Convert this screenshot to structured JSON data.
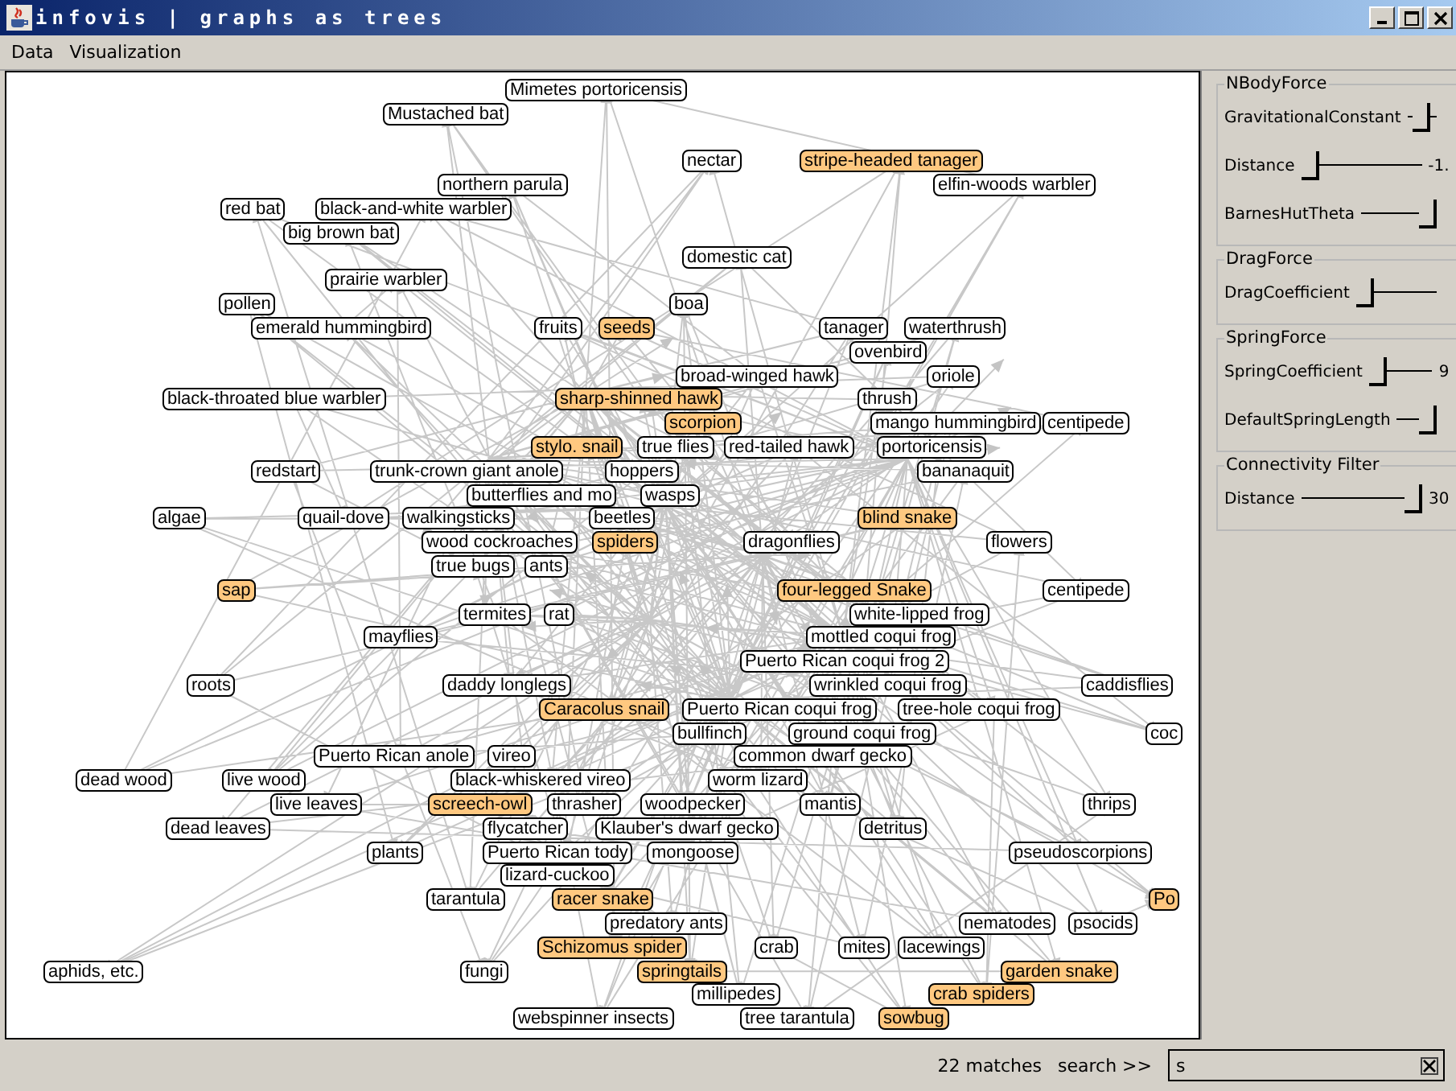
{
  "window": {
    "title": "infovis | graphs as trees"
  },
  "menu": [
    "Data",
    "Visualization"
  ],
  "graph": {
    "nodes": [
      {
        "label": "Mimetes portoricensis",
        "matched": false
      },
      {
        "label": "Mustached bat",
        "matched": false
      },
      {
        "label": "nectar",
        "matched": false
      },
      {
        "label": "stripe-headed tanager",
        "matched": true
      },
      {
        "label": "northern parula",
        "matched": false
      },
      {
        "label": "elfin-woods warbler",
        "matched": false
      },
      {
        "label": "red bat",
        "matched": false
      },
      {
        "label": "black-and-white warbler",
        "matched": false
      },
      {
        "label": "big brown bat",
        "matched": false
      },
      {
        "label": "domestic cat",
        "matched": false
      },
      {
        "label": "prairie warbler",
        "matched": false
      },
      {
        "label": "pollen",
        "matched": false
      },
      {
        "label": "boa",
        "matched": false
      },
      {
        "label": "emerald hummingbird",
        "matched": false
      },
      {
        "label": "fruits",
        "matched": false
      },
      {
        "label": "seeds",
        "matched": true
      },
      {
        "label": "tanager",
        "matched": false
      },
      {
        "label": "waterthrush",
        "matched": false
      },
      {
        "label": "ovenbird",
        "matched": false
      },
      {
        "label": "broad-winged hawk",
        "matched": false
      },
      {
        "label": "oriole",
        "matched": false
      },
      {
        "label": "black-throated blue warbler",
        "matched": false
      },
      {
        "label": "sharp-shinned hawk",
        "matched": true
      },
      {
        "label": "thrush",
        "matched": false
      },
      {
        "label": "scorpion",
        "matched": true
      },
      {
        "label": "mango hummingbird",
        "matched": false
      },
      {
        "label": "centipede",
        "matched": false
      },
      {
        "label": "stylo. snail",
        "matched": true
      },
      {
        "label": "true flies",
        "matched": false
      },
      {
        "label": "red-tailed hawk",
        "matched": false
      },
      {
        "label": "portoricensis",
        "matched": false
      },
      {
        "label": "redstart",
        "matched": false
      },
      {
        "label": "trunk-crown giant anole",
        "matched": false
      },
      {
        "label": "hoppers",
        "matched": false
      },
      {
        "label": "bananaquit",
        "matched": false
      },
      {
        "label": "butterflies and mo",
        "matched": false
      },
      {
        "label": "wasps",
        "matched": false
      },
      {
        "label": "algae",
        "matched": false
      },
      {
        "label": "quail-dove",
        "matched": false
      },
      {
        "label": "walkingsticks",
        "matched": false
      },
      {
        "label": "beetles",
        "matched": false
      },
      {
        "label": "blind snake",
        "matched": true
      },
      {
        "label": "wood cockroaches",
        "matched": false
      },
      {
        "label": "spiders",
        "matched": true
      },
      {
        "label": "dragonflies",
        "matched": false
      },
      {
        "label": "flowers",
        "matched": false
      },
      {
        "label": "true bugs",
        "matched": false
      },
      {
        "label": "ants",
        "matched": false
      },
      {
        "label": "sap",
        "matched": true
      },
      {
        "label": "four-legged Snake",
        "matched": true
      },
      {
        "label": "centipede",
        "matched": false
      },
      {
        "label": "termites",
        "matched": false
      },
      {
        "label": "rat",
        "matched": false
      },
      {
        "label": "white-lipped frog",
        "matched": false
      },
      {
        "label": "mayflies",
        "matched": false
      },
      {
        "label": "mottled coqui frog",
        "matched": false
      },
      {
        "label": "Puerto Rican coqui frog 2",
        "matched": false
      },
      {
        "label": "roots",
        "matched": false
      },
      {
        "label": "daddy longlegs",
        "matched": false
      },
      {
        "label": "wrinkled coqui frog",
        "matched": false
      },
      {
        "label": "caddisflies",
        "matched": false
      },
      {
        "label": "Caracolus snail",
        "matched": true
      },
      {
        "label": "Puerto Rican coqui frog",
        "matched": false
      },
      {
        "label": "tree-hole coqui frog",
        "matched": false
      },
      {
        "label": "bullfinch",
        "matched": false
      },
      {
        "label": "ground coqui frog",
        "matched": false
      },
      {
        "label": "coc",
        "matched": false
      },
      {
        "label": "Puerto Rican anole",
        "matched": false
      },
      {
        "label": "vireo",
        "matched": false
      },
      {
        "label": "common dwarf gecko",
        "matched": false
      },
      {
        "label": "dead wood",
        "matched": false
      },
      {
        "label": "live wood",
        "matched": false
      },
      {
        "label": "black-whiskered vireo",
        "matched": false
      },
      {
        "label": "worm lizard",
        "matched": false
      },
      {
        "label": "live leaves",
        "matched": false
      },
      {
        "label": "screech-owl",
        "matched": true
      },
      {
        "label": "thrasher",
        "matched": false
      },
      {
        "label": "woodpecker",
        "matched": false
      },
      {
        "label": "mantis",
        "matched": false
      },
      {
        "label": "thrips",
        "matched": false
      },
      {
        "label": "dead leaves",
        "matched": false
      },
      {
        "label": "flycatcher",
        "matched": false
      },
      {
        "label": "Klauber's dwarf gecko",
        "matched": false
      },
      {
        "label": "detritus",
        "matched": false
      },
      {
        "label": "plants",
        "matched": false
      },
      {
        "label": "Puerto Rican tody",
        "matched": false
      },
      {
        "label": "mongoose",
        "matched": false
      },
      {
        "label": "pseudoscorpions",
        "matched": false
      },
      {
        "label": "lizard-cuckoo",
        "matched": false
      },
      {
        "label": "tarantula",
        "matched": false
      },
      {
        "label": "racer snake",
        "matched": true
      },
      {
        "label": "Po",
        "matched": true
      },
      {
        "label": "predatory ants",
        "matched": false
      },
      {
        "label": "nematodes",
        "matched": false
      },
      {
        "label": "psocids",
        "matched": false
      },
      {
        "label": "Schizomus spider",
        "matched": true
      },
      {
        "label": "crab",
        "matched": false
      },
      {
        "label": "mites",
        "matched": false
      },
      {
        "label": "lacewings",
        "matched": false
      },
      {
        "label": "aphids, etc.",
        "matched": false
      },
      {
        "label": "fungi",
        "matched": false
      },
      {
        "label": "springtails",
        "matched": true
      },
      {
        "label": "garden snake",
        "matched": true
      },
      {
        "label": "millipedes",
        "matched": false
      },
      {
        "label": "crab spiders",
        "matched": true
      },
      {
        "label": "webspinner insects",
        "matched": false
      },
      {
        "label": "tree tarantula",
        "matched": false
      },
      {
        "label": "sowbug",
        "matched": true
      }
    ]
  },
  "panel": {
    "groups": [
      {
        "title": "NBodyForce",
        "sliders": [
          {
            "label": "GravitationalConstant",
            "level": 0.5
          },
          {
            "label": "Distance",
            "level": 0.0,
            "reading": "-1."
          },
          {
            "label": "BarnesHutTheta",
            "level": 1.0
          }
        ]
      },
      {
        "title": "DragForce",
        "sliders": [
          {
            "label": "DragCoefficient",
            "level": 0.0
          }
        ]
      },
      {
        "title": "SpringForce",
        "sliders": [
          {
            "label": "SpringCoefficient",
            "level": 0.0,
            "reading": "9"
          },
          {
            "label": "DefaultSpringLength",
            "level": 1.0
          }
        ]
      },
      {
        "title": "Connectivity Filter",
        "sliders": [
          {
            "label": "Distance",
            "level": 1.0,
            "reading": "30"
          }
        ]
      }
    ]
  },
  "status_bar": {
    "matches": "22 matches",
    "search_label": "search >>",
    "search_value": "s"
  }
}
